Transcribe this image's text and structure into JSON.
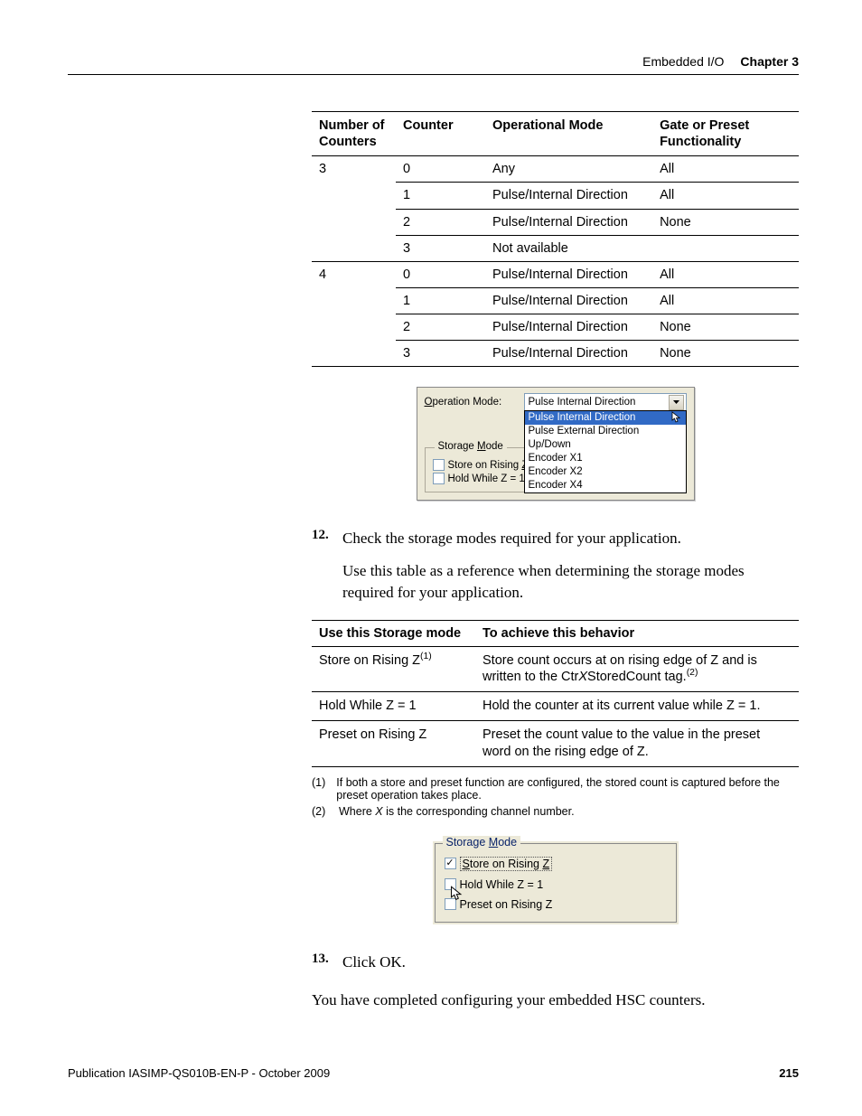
{
  "header": {
    "section": "Embedded I/O",
    "chapter": "Chapter 3"
  },
  "table1": {
    "headers": [
      "Number of Counters",
      "Counter",
      "Operational Mode",
      "Gate or Preset Functionality"
    ],
    "groups": [
      {
        "num": "3",
        "rows": [
          {
            "counter": "0",
            "mode": "Any",
            "func": "All"
          },
          {
            "counter": "1",
            "mode": "Pulse/Internal Direction",
            "func": "All"
          },
          {
            "counter": "2",
            "mode": "Pulse/Internal Direction",
            "func": "None"
          },
          {
            "counter": "3",
            "mode": "Not available",
            "func": "",
            "span": true
          }
        ]
      },
      {
        "num": "4",
        "rows": [
          {
            "counter": "0",
            "mode": "Pulse/Internal Direction",
            "func": "All"
          },
          {
            "counter": "1",
            "mode": "Pulse/Internal Direction",
            "func": "All"
          },
          {
            "counter": "2",
            "mode": "Pulse/Internal Direction",
            "func": "None"
          },
          {
            "counter": "3",
            "mode": "Pulse/Internal Direction",
            "func": "None"
          }
        ]
      }
    ]
  },
  "screenshot1": {
    "opmode_label_pre": "O",
    "opmode_label_post": "peration Mode:",
    "opmode_value": "Pulse Internal Direction",
    "options": [
      "Pulse Internal Direction",
      "Pulse External Direction",
      "Up/Down",
      "Encoder X1",
      "Encoder X2",
      "Encoder X4"
    ],
    "storage_label_pre": "Storage ",
    "storage_label_u": "M",
    "storage_label_post": "ode",
    "chk1_pre": "Store on Rising ",
    "chk1_u": "Z",
    "chk2": "Hold While Z = 1"
  },
  "step12": {
    "num": "12.",
    "text": "Check the storage modes required for your application.",
    "para": "Use this table as a reference when determining the storage modes required for your application."
  },
  "table2": {
    "headers": [
      "Use this Storage mode",
      "To achieve this behavior"
    ],
    "rows": [
      {
        "mode": "Store on Rising Z",
        "mode_sup": "(1)",
        "beh_pre": "Store count occurs at on rising edge of Z and is written to the Ctr",
        "beh_em": "X",
        "beh_post": "StoredCount tag.",
        "beh_sup": "(2)"
      },
      {
        "mode": "Hold While Z = 1",
        "beh": "Hold the counter at its current value while Z = 1."
      },
      {
        "mode": "Preset on Rising Z",
        "beh": "Preset the count value to the value in the preset word on the rising edge of Z."
      }
    ]
  },
  "footnotes": {
    "f1": {
      "mark": "(1)",
      "text": "If both a store and preset function are configured, the stored count is captured before the preset operation takes place."
    },
    "f2": {
      "mark": "(2)",
      "pre": "Where ",
      "em": "X",
      "post": " is the corresponding channel number."
    }
  },
  "screenshot2": {
    "legend_pre": "Storage ",
    "legend_u": "M",
    "legend_post": "ode",
    "chk1_pre": "S",
    "chk1_post": "tore on Rising ",
    "chk1_end": "Z",
    "chk2": "Hold While Z = 1",
    "chk3": "Preset on Rising Z"
  },
  "step13": {
    "num": "13.",
    "text": "Click OK."
  },
  "closing": "You have completed configuring your embedded HSC counters.",
  "footer": {
    "pub": "Publication IASIMP-QS010B-EN-P - October 2009",
    "page": "215"
  }
}
